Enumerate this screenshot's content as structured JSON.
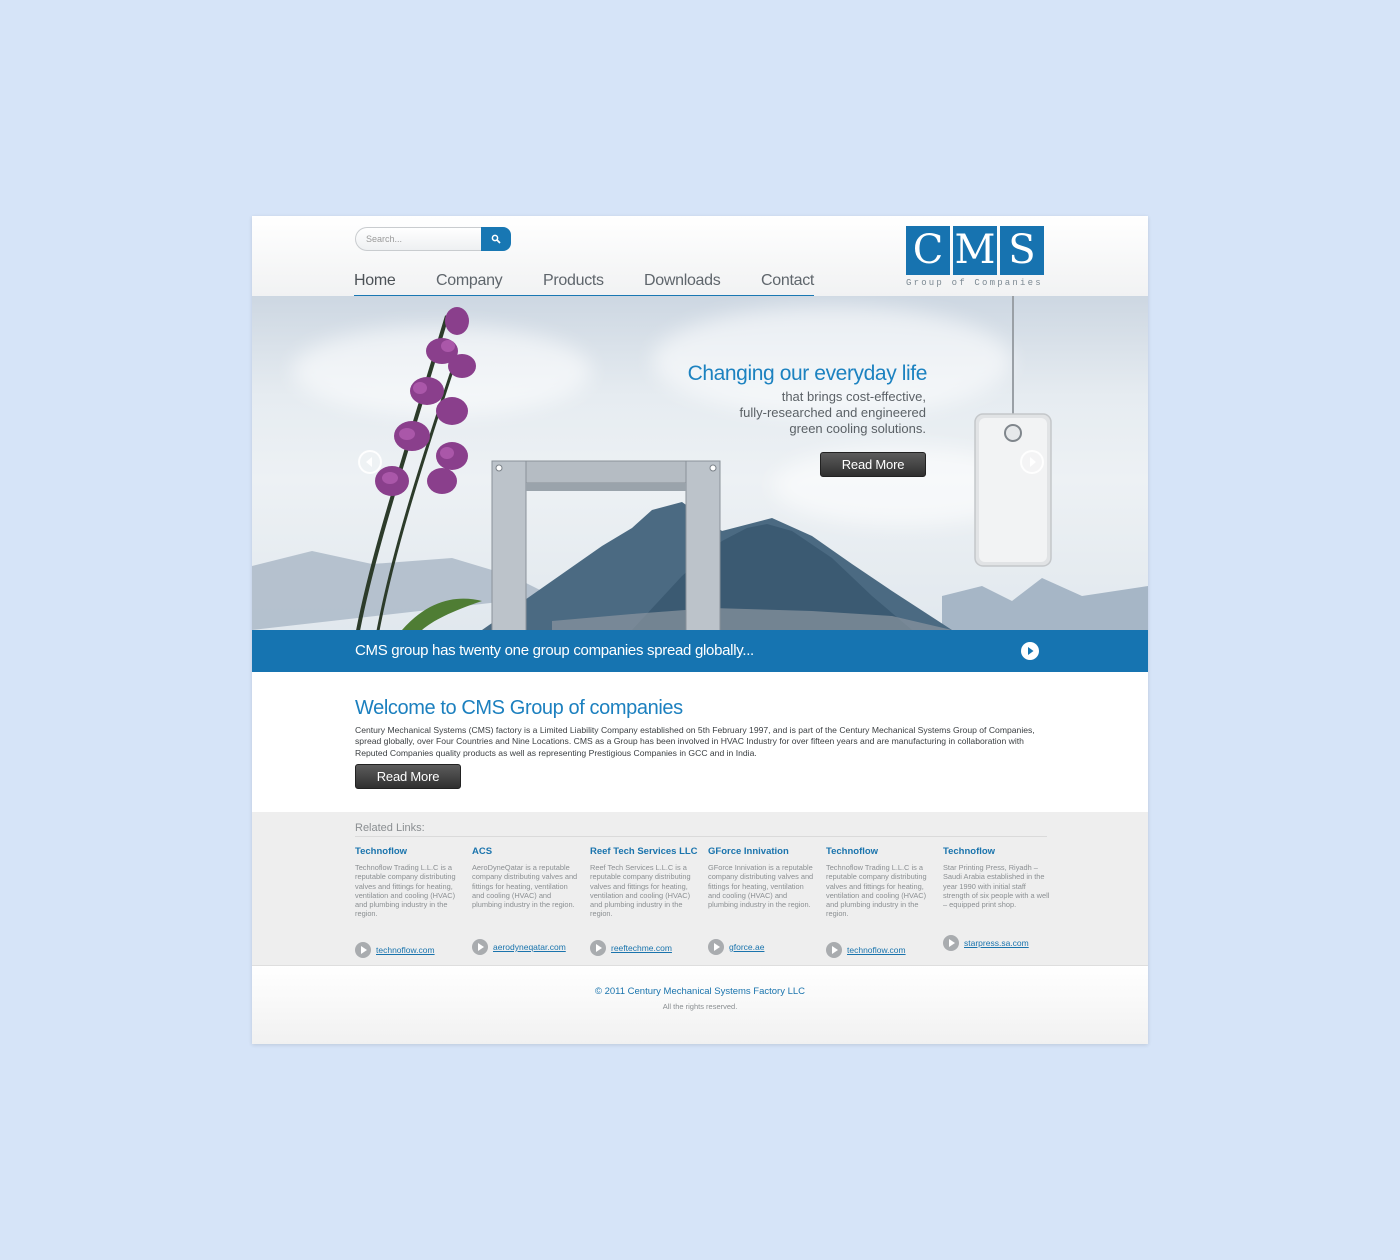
{
  "search": {
    "placeholder": "Search..."
  },
  "nav": {
    "items": [
      {
        "label": "Home"
      },
      {
        "label": "Company"
      },
      {
        "label": "Products"
      },
      {
        "label": "Downloads"
      },
      {
        "label": "Contact"
      }
    ],
    "active": "Home"
  },
  "logo": {
    "letters": [
      "C",
      "M",
      "S"
    ],
    "tagline": "Group of Companies"
  },
  "hero": {
    "title": "Changing our everyday life",
    "lines": [
      "that brings cost-effective,",
      "fully-researched and engineered",
      "green cooling solutions."
    ],
    "button_label": "Read More"
  },
  "banner": {
    "text": "CMS group has twenty one group companies spread globally..."
  },
  "welcome": {
    "title": "Welcome to CMS Group of companies",
    "body": "Century Mechanical Systems (CMS) factory is a Limited Liability Company established on 5th February 1997, and is part of the Century Mechanical Systems Group of Companies, spread globally, over Four Countries and Nine Locations. CMS as a Group has been involved in HVAC Industry for over fifteen years and are manufacturing in collaboration with Reputed Companies quality products as well as representing Prestigious Companies in GCC and in India.",
    "button_label": "Read More"
  },
  "related": {
    "title": "Related Links:",
    "items": [
      {
        "title": "Technoflow",
        "desc": "Technoflow Trading L.L.C is a reputable company distributing valves and fittings for heating, ventilation and cooling (HVAC) and plumbing industry in the region.",
        "link": "technoflow.com"
      },
      {
        "title": "ACS",
        "desc": "AeroDyneQatar is a reputable company distributing valves and fittings for heating, ventilation and cooling (HVAC) and plumbing industry in the region.",
        "link": "aerodyneqatar.com"
      },
      {
        "title": "Reef Tech Services LLC",
        "desc": "Reef Tech Services L.L.C is a reputable company distributing valves and fittings for heating, ventilation and cooling (HVAC) and plumbing industry in the region.",
        "link": "reeftechme.com"
      },
      {
        "title": "GForce Innivation",
        "desc": "GForce Innivation is a reputable company distributing valves and fittings for heating, ventilation and cooling (HVAC) and plumbing industry in the region.",
        "link": "gforce.ae"
      },
      {
        "title": "Technoflow",
        "desc": "Technoflow Trading L.L.C is a reputable company distributing valves and fittings for heating, ventilation and cooling (HVAC) and plumbing industry in the region.",
        "link": "technoflow.com"
      },
      {
        "title": "Technoflow",
        "desc": "Star Printing Press, Riyadh – Saudi Arabia established in the year 1990 with initial staff strength of six people with a well – equipped print shop.",
        "link": "starpress.sa.com"
      }
    ]
  },
  "footer": {
    "copyright": "© 2011 Century Mechanical Systems Factory LLC",
    "rights": "All the rights reserved."
  },
  "colors": {
    "accent": "#1674b1",
    "background": "#d6e4f8",
    "dark_button": "#3a3a3a"
  }
}
